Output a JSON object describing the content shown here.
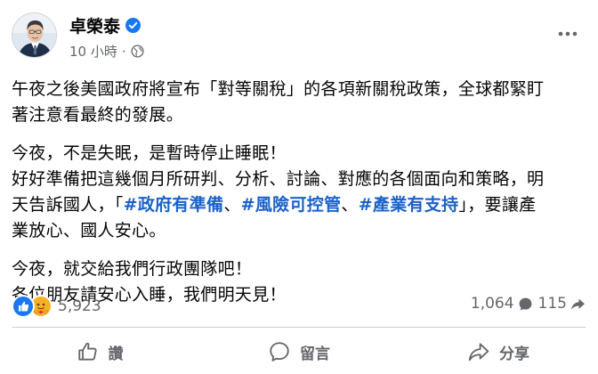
{
  "post": {
    "author": "卓榮泰",
    "time": "10 小時",
    "time_separator": "·",
    "paragraphs": [
      {
        "lines": [
          "午夜之後美國政府將宣布「對等關稅」的各項新關稅政策，全球都緊盯",
          "著注意看最終的發展。"
        ]
      },
      {
        "line1": "今夜，不是失眠，是暫時停止睡眠！",
        "line2": "好好準備把這幾個月所研判、分析、討論、對應的各個面向和策略，明",
        "line3_prefix": "天告訴國人，「",
        "hashtag1": "#政府有準備",
        "sep1": "、",
        "hashtag2": "#風險可控管",
        "sep2": "、",
        "hashtag3": "#產業有支持",
        "line3_suffix": "」，要讓產",
        "line4": "業放心、國人安心。"
      },
      {
        "lines": [
          "今夜，就交給我們行政團隊吧！",
          "各位朋友請安心入睡，我們明天見！"
        ]
      }
    ]
  },
  "stats": {
    "reactions": "5,923",
    "comments": "1,064",
    "shares": "115"
  },
  "actions": {
    "like": "讚",
    "comment": "留言",
    "share": "分享"
  },
  "icons": {
    "verified": "verified-badge-icon",
    "globe": "globe-icon",
    "more": "more-icon",
    "like_reaction": "like-reaction-icon",
    "care_reaction": "care-reaction-icon",
    "comment": "comment-icon",
    "share": "share-icon",
    "like": "thumbs-up-icon"
  },
  "colors": {
    "brand_blue": "#1877f2",
    "hashtag": "#1b62c9",
    "secondary_text": "#65676b"
  }
}
